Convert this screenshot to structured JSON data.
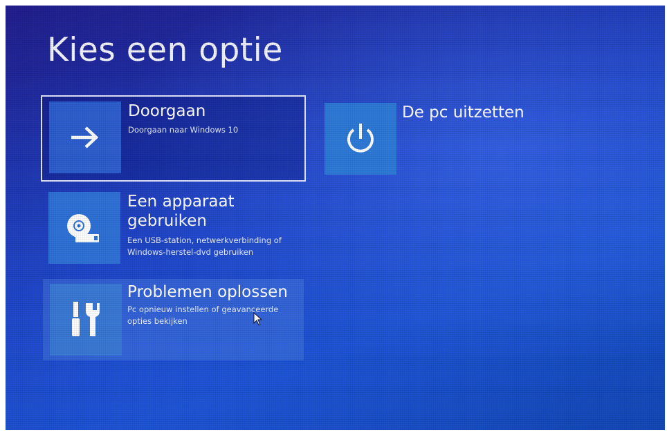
{
  "page": {
    "title": "Kies een optie"
  },
  "options": [
    {
      "title": "Doorgaan",
      "description": "Doorgaan naar Windows 10",
      "icon": "arrow-right-icon",
      "selected": true
    },
    {
      "title": "Een apparaat gebruiken",
      "description": "Een USB-station, netwerkverbinding of Windows-herstel-dvd gebruiken",
      "icon": "usb-disc-icon"
    },
    {
      "title": "Problemen oplossen",
      "description": "Pc opnieuw instellen of geavanceerde opties bekijken",
      "icon": "tools-icon",
      "hovered": true
    },
    {
      "title": "De pc uitzetten",
      "icon": "power-icon"
    }
  ],
  "colors": {
    "background": "#1d3fbd",
    "tile": "#2a6fd9",
    "text": "#ffffff"
  }
}
